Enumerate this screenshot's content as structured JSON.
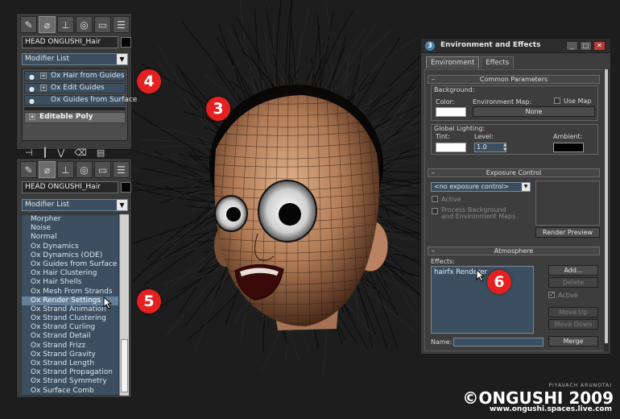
{
  "panel_top": {
    "tab_icons": [
      "create-icon",
      "modify-icon",
      "hierarchy-icon",
      "motion-icon",
      "display-icon",
      "utilities-icon"
    ],
    "object_name": "HEAD ONGUSHI_Hair",
    "modifier_list_label": "Modifier List",
    "stack_items": [
      {
        "label": "Ox Hair from Guides"
      },
      {
        "label": "Ox Edit Guides"
      },
      {
        "label": "Ox Guides from Surface"
      }
    ],
    "base_object": "Editable Poly"
  },
  "panel_bottom": {
    "object_name": "HEAD ONGUSHI_Hair",
    "modifier_list_label": "Modifier List",
    "modifier_items": [
      "Morpher",
      "Noise",
      "Normal",
      "Ox Dynamics",
      "Ox Dynamics (ODE)",
      "Ox Guides from Surface",
      "Ox Hair Clustering",
      "Ox Hair Shells",
      "Ox Mesh From Strands",
      "Ox Render Settings",
      "Ox Strand Animation",
      "Ox Strand Clustering",
      "Ox Strand Curling",
      "Ox Strand Detail",
      "Ox Strand Frizz",
      "Ox Strand Gravity",
      "Ox Strand Length",
      "Ox Strand Propagation",
      "Ox Strand Symmetry",
      "Ox Surface Comb"
    ],
    "highlighted_item": "Ox Render Settings"
  },
  "markers": {
    "m3": "3",
    "m4": "4",
    "m5": "5",
    "m6": "6"
  },
  "env_window": {
    "title": "Environment and Effects",
    "tabs": [
      "Environment",
      "Effects"
    ],
    "common_params": {
      "rollout": "Common Parameters",
      "background": "Background:",
      "color": "Color:",
      "env_map": "Environment Map:",
      "use_map": "Use Map",
      "none_button": "None",
      "global_lighting": "Global Lighting:",
      "tint": "Tint:",
      "level": "Level:",
      "level_value": "1.0",
      "ambient": "Ambient:"
    },
    "exposure": {
      "rollout": "Exposure Control",
      "selected": "<no exposure control>",
      "active": "Active",
      "process_bg": "Process Background",
      "process_env": "and Environment Maps",
      "render_preview": "Render Preview"
    },
    "atmosphere": {
      "rollout": "Atmosphere",
      "effects_label": "Effects:",
      "effects_item": "hairfx Renderer",
      "add": "Add...",
      "delete": "Delete",
      "active": "Active",
      "move_up": "Move Up",
      "move_down": "Move Down",
      "name_label": "Name:",
      "merge": "Merge"
    }
  },
  "credit": {
    "small": "PIYAVACH ARUNOTAI",
    "big": "©ONGUSHI 2009",
    "url": "www.ongushi.spaces.live.com"
  },
  "colors": {
    "accent_blue": "#3c4f60",
    "marker_red": "#e52020"
  }
}
